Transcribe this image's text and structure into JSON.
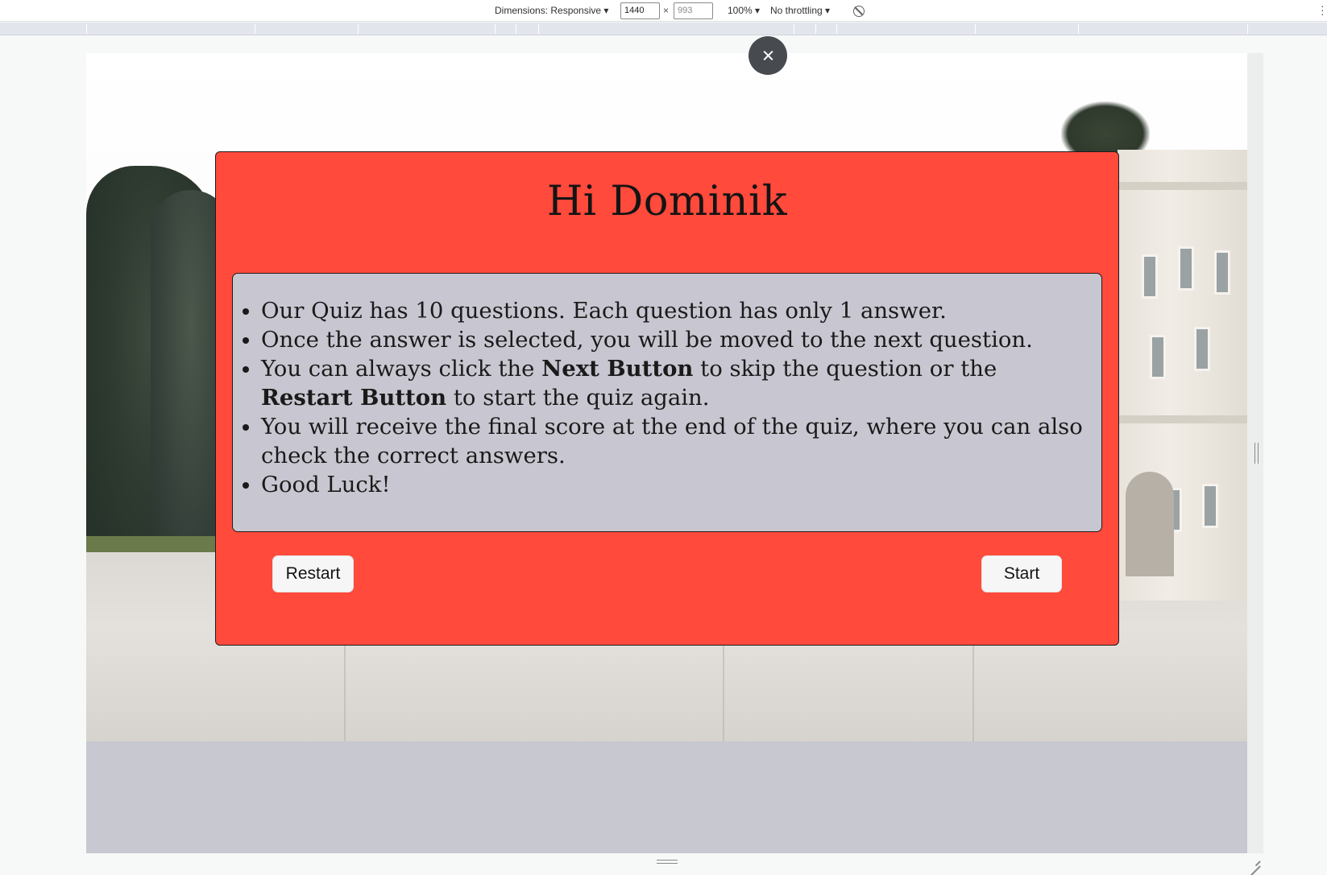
{
  "devtools": {
    "dimensions_label": "Dimensions: Responsive ▾",
    "width_value": "1440",
    "height_value": "993",
    "times": "×",
    "zoom_label": "100% ▾",
    "throttle_label": "No throttling ▾",
    "rotate_icon": "rotate-icon",
    "more_icon": "more-vert-icon"
  },
  "modal": {
    "title": "Hi Dominik",
    "rules": {
      "item1": "Our Quiz has 10 questions. Each question has only 1 answer.",
      "item2": "Once the answer is selected, you will be moved to the next question.",
      "item3_part1": "You can always click the ",
      "item3_bold1": "Next Button",
      "item3_part2": " to skip the question or the ",
      "item3_bold2": "Restart Button",
      "item3_part3": " to start the quiz again.",
      "item4": "You will receive the final score at the end of the quiz, where you can also check the correct answers.",
      "item5": "Good Luck!"
    },
    "restart_label": "Restart",
    "start_label": "Start",
    "close_icon": "close-icon"
  },
  "colors": {
    "modal_bg": "#ff4a3c",
    "rules_bg": "#c8c7d1",
    "close_btn_bg": "#474b4f",
    "page_bottom_bg": "#c8c8d0"
  }
}
